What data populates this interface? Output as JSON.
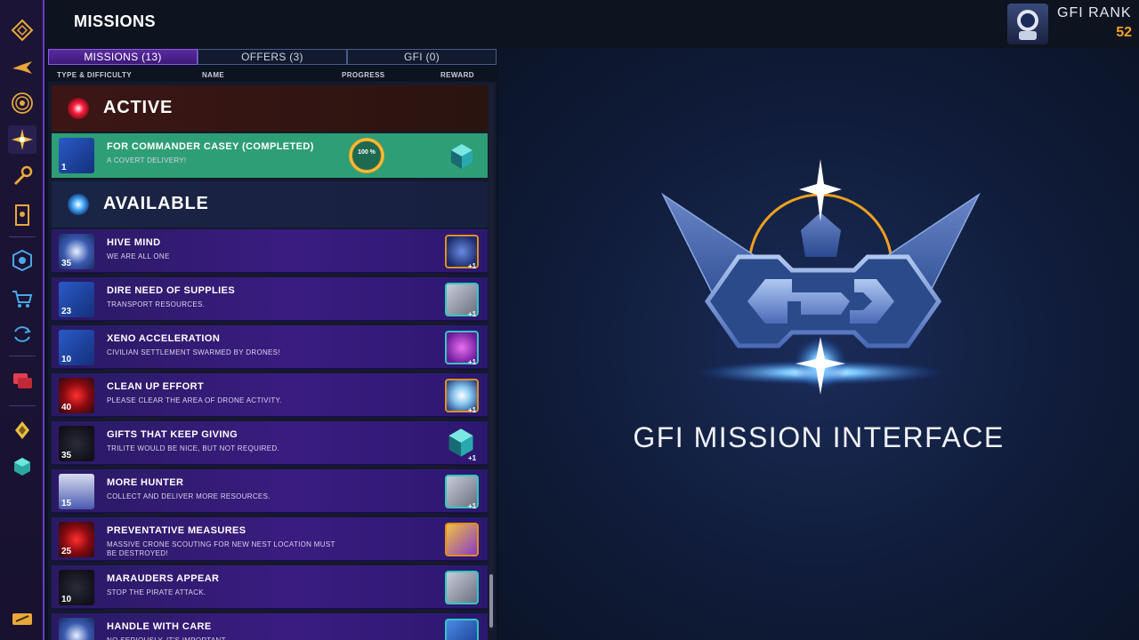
{
  "header": {
    "title": "MISSIONS",
    "rank_label": "GFI RANK",
    "rank_value": "52"
  },
  "tabs": [
    {
      "label": "MISSIONS (13)",
      "active": true
    },
    {
      "label": "OFFERS (3)",
      "active": false
    },
    {
      "label": "GFI (0)",
      "active": false
    }
  ],
  "columns": {
    "type": "TYPE & DIFFICULTY",
    "name": "NAME",
    "progress": "PROGRESS",
    "reward": "REWARD"
  },
  "sections": {
    "active": "ACTIVE",
    "available": "AVAILABLE"
  },
  "active_mission": {
    "name": "FOR COMMANDER CASEY (COMPLETED)",
    "desc": "A COVERT DELIVERY!",
    "level": "1",
    "progress": "100 %",
    "progress_fraction": 1.0
  },
  "missions": [
    {
      "name": "HIVE MIND",
      "desc": "WE ARE ALL ONE",
      "level": "35",
      "reward_extra": "+1",
      "reward_icon": "orbital-target-icon"
    },
    {
      "name": "DIRE NEED OF SUPPLIES",
      "desc": "TRANSPORT RESOURCES.",
      "level": "23",
      "reward_extra": "+1",
      "reward_icon": "cargo-crate-icon"
    },
    {
      "name": "XENO ACCELERATION",
      "desc": "CIVILIAN SETTLEMENT SWARMED BY DRONES!",
      "level": "10",
      "reward_extra": "+1",
      "reward_icon": "purple-module-icon"
    },
    {
      "name": "CLEAN UP EFFORT",
      "desc": "PLEASE CLEAR THE AREA OF DRONE ACTIVITY.",
      "level": "40",
      "reward_extra": "+1",
      "reward_icon": "energy-orb-icon"
    },
    {
      "name": "GIFTS THAT KEEP GIVING",
      "desc": "TRILITE WOULD BE NICE, BUT NOT REQUIRED.",
      "level": "35",
      "reward_extra": "+1",
      "reward_icon": "trilite-crystal-icon"
    },
    {
      "name": "MORE HUNTER",
      "desc": "COLLECT AND DELIVER MORE RESOURCES.",
      "level": "15",
      "reward_extra": "+1",
      "reward_icon": "cargo-crate-icon"
    },
    {
      "name": "PREVENTATIVE MEASURES",
      "desc": "MASSIVE CRONE SCOUTING FOR NEW NEST LOCATION MUST BE DESTROYED!",
      "level": "25",
      "reward_extra": "",
      "reward_icon": "weapon-icon"
    },
    {
      "name": "MARAUDERS APPEAR",
      "desc": "STOP THE PIRATE ATTACK.",
      "level": "10",
      "reward_extra": "",
      "reward_icon": "cargo-crate-icon"
    },
    {
      "name": "HANDLE WITH CARE",
      "desc": "NO SERIOUSLY, IT'S IMPORTANT.",
      "level": "",
      "reward_extra": "",
      "reward_icon": "blue-cube-icon"
    }
  ],
  "right_panel": {
    "title": "GFI MISSION INTERFACE"
  },
  "colors": {
    "accent_purple": "#6a3cc8",
    "active_green": "#2e9e76",
    "rank_orange": "#f0a028"
  }
}
